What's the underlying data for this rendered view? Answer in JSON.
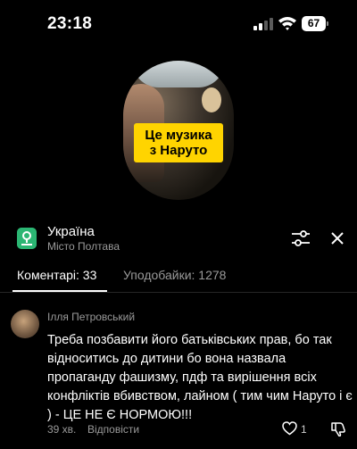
{
  "status_bar": {
    "time": "23:18",
    "battery": "67"
  },
  "video": {
    "caption_line1": "Це музика",
    "caption_line2": "з Наруто"
  },
  "location": {
    "title": "Україна",
    "subtitle": "Місто Полтава"
  },
  "tabs": [
    {
      "label": "Коментарі: 33",
      "active": true
    },
    {
      "label": "Уподобайки: 1278",
      "active": false
    }
  ],
  "comment": {
    "author": "Ілля Петровський",
    "text": "Треба позбавити його батьківських прав, бо так відноситись до дитини бо вона назвала пропаганду фашизму, пдф та вирішення всіх конфліктів вбивством, лайном ( тим чим Наруто і є ) - ЦЕ НЕ Є НОРМОЮ!!!",
    "time": "39 хв.",
    "reply_label": "Відповісти",
    "likes": "1"
  },
  "colors": {
    "accent_green": "#2bb673",
    "caption_yellow": "#ffd400",
    "muted_text": "#9a9a9a"
  }
}
